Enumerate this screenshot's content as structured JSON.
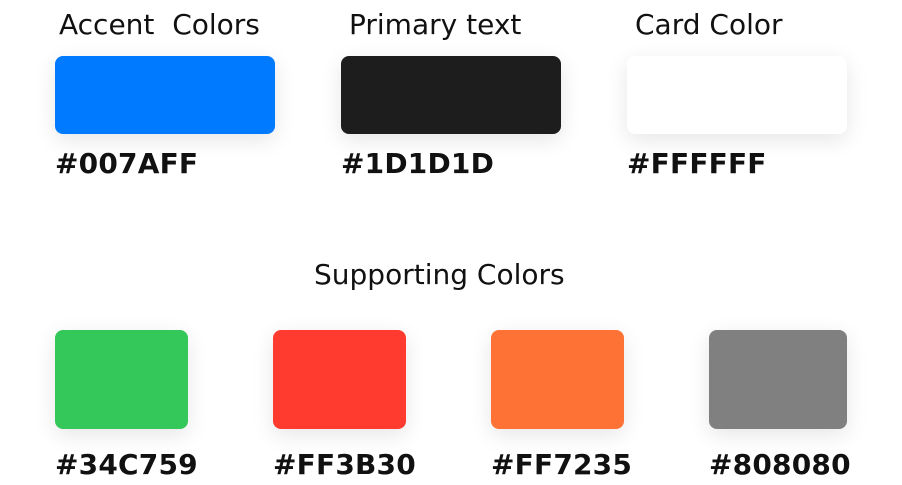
{
  "primary": {
    "accent": {
      "label": "Accent  Colors",
      "hex": "#007AFF",
      "color": "#007AFF"
    },
    "text": {
      "label": "Primary text",
      "hex": "#1D1D1D",
      "color": "#1D1D1D"
    },
    "card": {
      "label": "Card Color",
      "hex": "#FFFFFF",
      "color": "#FFFFFF"
    }
  },
  "supporting": {
    "title": "Supporting Colors",
    "swatches": [
      {
        "hex": "#34C759",
        "color": "#34C759"
      },
      {
        "hex": "#FF3B30",
        "color": "#FF3B30"
      },
      {
        "hex": "#FF7235",
        "color": "#FF7235"
      },
      {
        "hex": "#808080",
        "color": "#808080"
      }
    ]
  }
}
